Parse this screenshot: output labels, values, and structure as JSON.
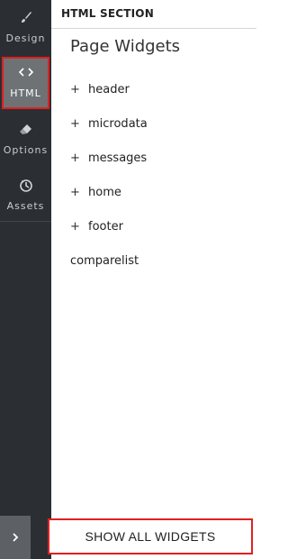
{
  "sidebar": {
    "items": [
      {
        "label": "Design",
        "icon": "paintbrush-icon"
      },
      {
        "label": "HTML",
        "icon": "code-icon",
        "active": true
      },
      {
        "label": "Options",
        "icon": "eraser-icon"
      },
      {
        "label": "Assets",
        "icon": "assets-icon"
      }
    ],
    "toggle_icon": "chevron-right-icon"
  },
  "panel": {
    "section_header": "HTML SECTION",
    "title": "Page Widgets",
    "widgets": [
      {
        "label": "header",
        "expand": "+"
      },
      {
        "label": "microdata",
        "expand": "+"
      },
      {
        "label": "messages",
        "expand": "+"
      },
      {
        "label": "home",
        "expand": "+"
      },
      {
        "label": "footer",
        "expand": "+"
      },
      {
        "label": "comparelist",
        "expand": ""
      }
    ],
    "show_all_label": "SHOW ALL WIDGETS"
  },
  "colors": {
    "sidebar_bg": "#2b2f33",
    "active_bg": "#6f7275",
    "highlight_border": "#e02020"
  }
}
